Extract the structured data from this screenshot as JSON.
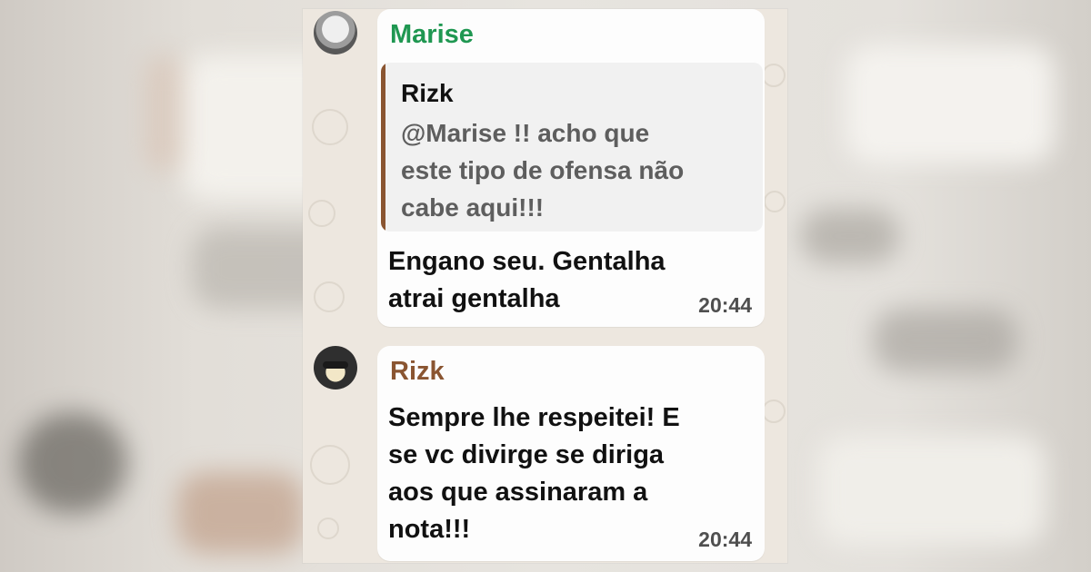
{
  "messages": [
    {
      "sender": "Marise",
      "quote": {
        "author": "Rizk",
        "text": "@Marise  !! acho que\neste tipo de ofensa não\ncabe aqui!!!"
      },
      "text": "Engano seu. Gentalha\natrai gentalha",
      "time": "20:44"
    },
    {
      "sender": "Rizk",
      "text": "Sempre lhe respeitei! E\nse vc divirge se diriga\naos que assinaram a\nnota!!!",
      "time": "20:44"
    }
  ],
  "colors": {
    "marise_name": "#1f9751",
    "rizk_name": "#8a5531",
    "chat_bg": "#ede7df",
    "bubble_bg": "#fdfdfd",
    "quote_bg": "#f1f1f1"
  }
}
